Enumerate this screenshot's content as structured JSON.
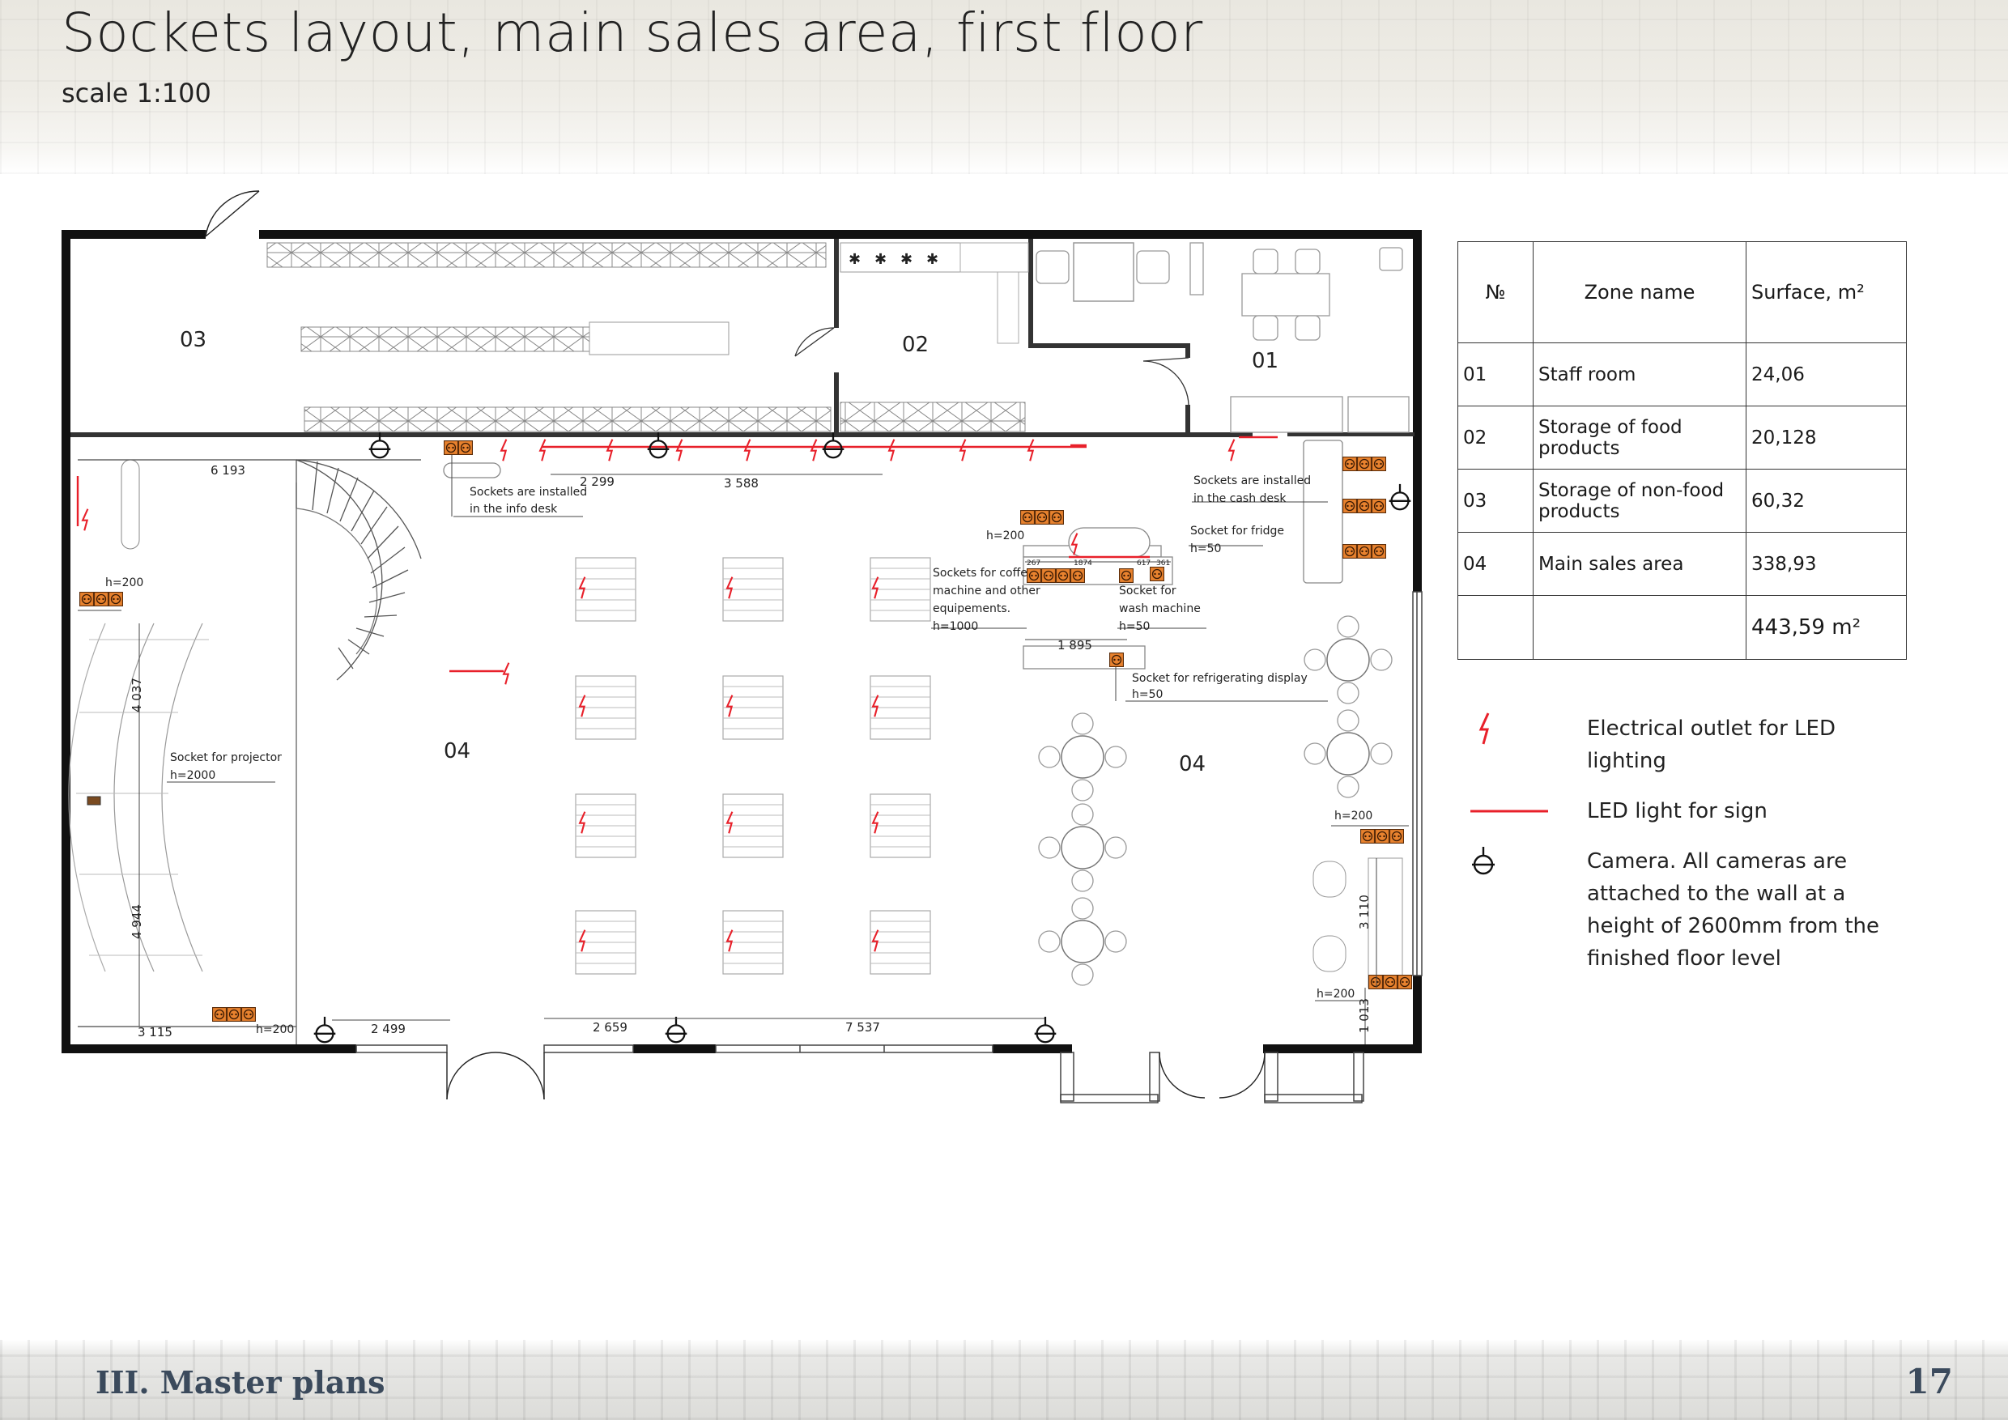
{
  "title": "Sockets layout, main sales area, first floor",
  "subtitle": "scale 1:100",
  "footer": {
    "section": "III. Master plans",
    "page_number": "17"
  },
  "colors": {
    "accent_red": "#e8202a",
    "socket_orange": "#e8822e",
    "wall": "#111111"
  },
  "zones_table": {
    "headers": [
      "№",
      "Zone name",
      "Surface, m²"
    ],
    "rows": [
      {
        "num": "01",
        "name": "Staff room",
        "surface": "24,06"
      },
      {
        "num": "02",
        "name": "Storage of food products",
        "surface": "20,128"
      },
      {
        "num": "03",
        "name": "Storage of non-food products",
        "surface": "60,32"
      },
      {
        "num": "04",
        "name": "Main sales area",
        "surface": "338,93"
      }
    ],
    "total": "443,59 m²"
  },
  "legend": [
    {
      "icon": "led-outlet-icon",
      "text": "Electrical outlet for LED lighting"
    },
    {
      "icon": "led-sign-line-icon",
      "text": "LED light for sign"
    },
    {
      "icon": "camera-icon",
      "text": "Camera. All cameras are attached to the wall at a height of 2600mm from the finished floor level"
    }
  ],
  "plan": {
    "zone_labels": [
      "03",
      "02",
      "01",
      "04",
      "04"
    ],
    "notes": {
      "info_desk_1": "Sockets are installed",
      "info_desk_2": "in the info desk",
      "cash_desk_1": "Sockets are installed",
      "cash_desk_2": "in the cash desk",
      "fridge": "Socket for fridge",
      "fridge_h": "h=50",
      "coffee_h_top": "h=200",
      "coffee_1": "Sockets for coffe",
      "coffee_2": "machine and other",
      "coffee_3": "equipements.",
      "coffee_h": "h=1000",
      "wash_1": "Socket for",
      "wash_2": "wash machine",
      "wash_h": "h=50",
      "display": "Socket for refrigerating display",
      "display_h": "h=50",
      "projector": "Socket for projector",
      "projector_h": "h=2000",
      "left_h": "h=200",
      "bottom_h": "h=200",
      "right_h1": "h=200",
      "right_h2": "h=200"
    },
    "dimensions": {
      "d6193": "6 193",
      "d2299": "2 299",
      "d3588": "3 588",
      "d1895": "1 895",
      "d4037": "4 037",
      "d4944": "4 944",
      "d3115": "3 115",
      "d2499": "2 499",
      "d2659": "2 659",
      "d7537": "7 537",
      "d3110": "3 110",
      "d1013": "1 013",
      "d1874": "1874",
      "d617": "617",
      "d361": "361",
      "d267": "267"
    }
  }
}
